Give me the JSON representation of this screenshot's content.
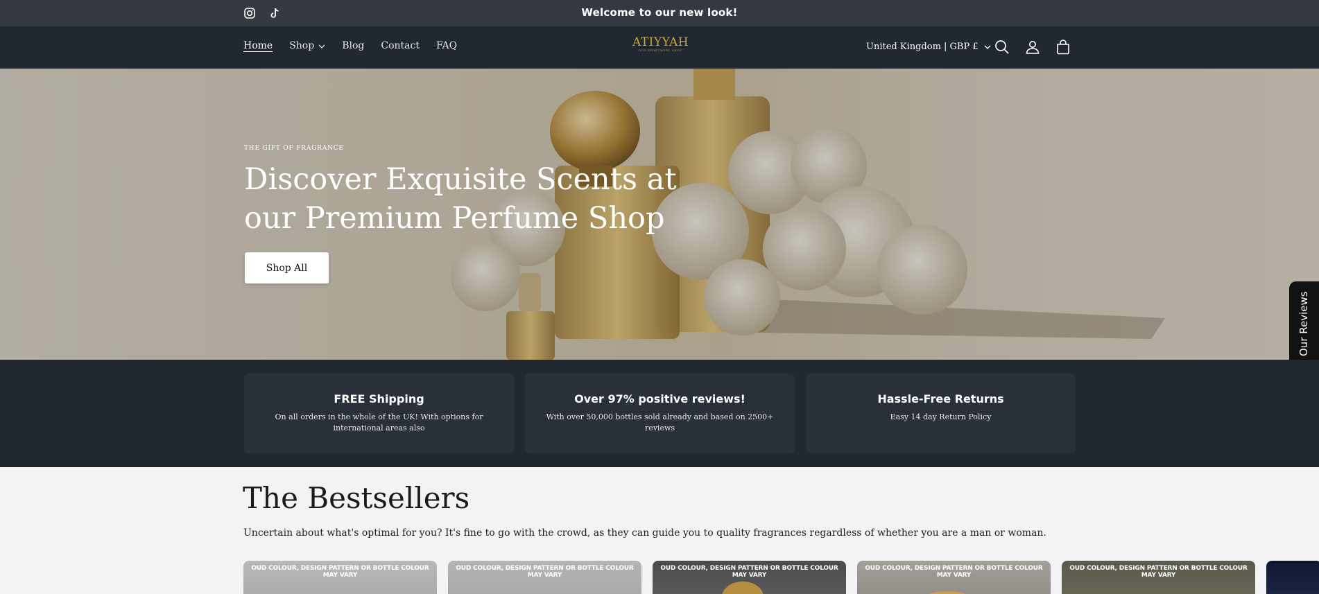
{
  "announcement": {
    "message": "Welcome to our new look!",
    "social": [
      "instagram-icon",
      "tiktok-icon"
    ]
  },
  "header": {
    "nav": [
      {
        "label": "Home",
        "active": true
      },
      {
        "label": "Shop",
        "has_dropdown": true
      },
      {
        "label": "Blog"
      },
      {
        "label": "Contact"
      },
      {
        "label": "FAQ"
      }
    ],
    "logo": {
      "name": "ATIYYAH",
      "tagline": "OUD PERFUMERY SHOP"
    },
    "country_selector": "United Kingdom | GBP £",
    "icons": [
      "search-icon",
      "account-icon",
      "cart-icon"
    ]
  },
  "hero": {
    "eyebrow": "THE GIFT OF FRAGRANCE",
    "heading": "Discover Exquisite Scents at our Premium Perfume Shop",
    "button": "Shop All"
  },
  "reviews_tab": {
    "label": "Our Reviews",
    "icon": "star-icon"
  },
  "features": [
    {
      "title": "FREE Shipping",
      "text": "On all orders in the whole of the UK! With options for international areas also"
    },
    {
      "title": "Over 97% positive reviews!",
      "text": "With over 50,000 bottles sold already and based on 2500+ reviews"
    },
    {
      "title": "Hassle-Free Returns",
      "text": "Easy 14 day Return Policy"
    }
  ],
  "bestsellers": {
    "title": "The Bestsellers",
    "subtitle": "Uncertain about what's optimal for you? It's fine to go with the crowd, as they can guide you to quality fragrances regardless of whether you are a man or woman.",
    "card_note": "OUD COLOUR,  DESIGN PATTERN OR BOTTLE COLOUR MAY VARY"
  },
  "colors": {
    "announcement_bg": "#343841",
    "header_bg": "#212830",
    "feature_card_bg": "#2a3038",
    "logo_gold": "#c9a43a",
    "page_bg": "#f3f3f3"
  }
}
